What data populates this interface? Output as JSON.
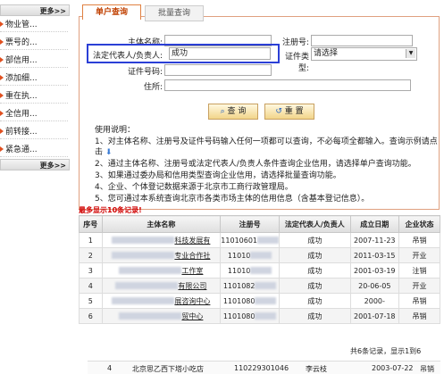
{
  "sidebar": {
    "more_label_1": "更多>>",
    "more_label_2": "更多>>",
    "items": [
      "物业管...",
      "票号的...",
      "部信用...",
      "添加细...",
      "重在执...",
      "全信用...",
      "前转接...",
      "紧急通..."
    ]
  },
  "tabs": {
    "single": "单户查询",
    "batch": "批量查询"
  },
  "form": {
    "subject_name_label": "主体名称",
    "reg_no_label": "注册号",
    "legal_rep_label": "法定代表人/负责人",
    "legal_rep_value": "成功",
    "cert_type_label": "证件类型",
    "cert_type_value": "请选择",
    "cert_no_label": "证件号码",
    "address_label": "住所"
  },
  "buttons": {
    "query": "查 询",
    "reset": "重 置"
  },
  "help": {
    "title": "使用说明：",
    "lines": [
      "1、对主体名称、注册号及证件号码输入任何一项都可以查询，不必每项全都输入。查询示例请点",
      "击",
      "2、通过主体名称、注册号或法定代表人/负责人条件查询企业信用，请选择单户查询功能。",
      "3、如果通过委办局和信用类型查询企业信用，请选择批量查询功能。",
      "4、企业、个体登记数据来源于北京市工商行政管理局。",
      "5、您可通过本系统查询北京市各类市场主体的信用信息（含基本登记信息）。"
    ]
  },
  "results": {
    "notice": "最多显示10条记录!",
    "headers": [
      "序号",
      "主体名称",
      "注册号",
      "法定代表人/负责人",
      "成立日期",
      "企业状态"
    ],
    "rows": [
      {
        "no": "1",
        "name": "科技发展有",
        "reg": "11010601",
        "rep": "成功",
        "date": "2007-11-23",
        "status": "吊销"
      },
      {
        "no": "2",
        "name": "专业合作社",
        "reg": "11010",
        "rep": "成功",
        "date": "2011-03-15",
        "status": "开业"
      },
      {
        "no": "3",
        "name": "工作室",
        "reg": "11010",
        "rep": "成功",
        "date": "2001-03-19",
        "status": "注销"
      },
      {
        "no": "4",
        "name": "有限公司",
        "reg": "1101082",
        "rep": "成功",
        "date": "20-06-05",
        "status": "开业"
      },
      {
        "no": "5",
        "name": "展咨询中心",
        "reg": "1101080",
        "rep": "成功",
        "date": "2000-",
        "status": "吊销"
      },
      {
        "no": "6",
        "name": "贸中心",
        "reg": "1101080",
        "rep": "成功",
        "date": "2001-07-18",
        "status": "吊销"
      }
    ],
    "footer": "共6条记录，显示1到6",
    "extra_row": {
      "no": "4",
      "name": "北京思乙西下塔小吃店",
      "reg": "110229301046",
      "rep": "李云枝",
      "date": "2003-07-22",
      "status": "吊销"
    }
  }
}
